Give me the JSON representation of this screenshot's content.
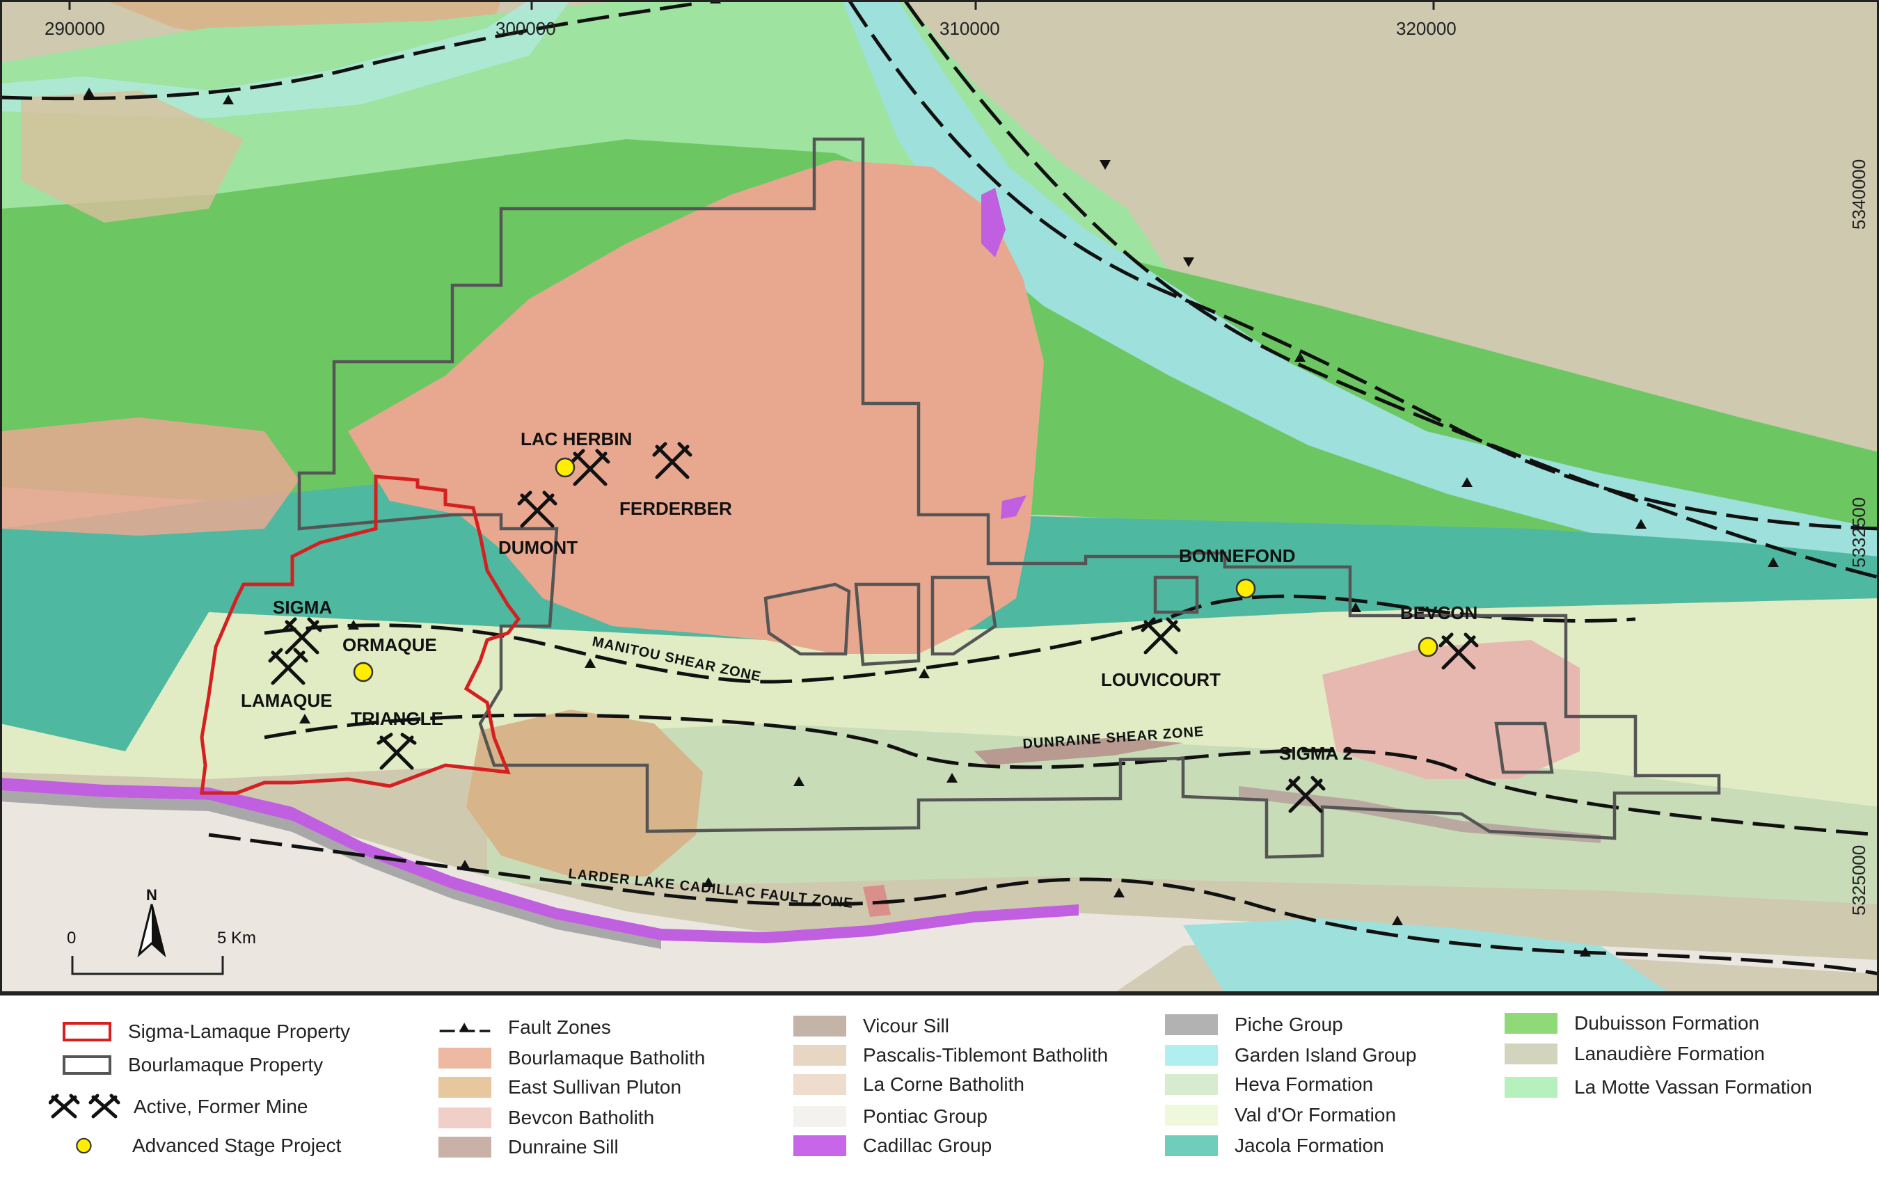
{
  "map": {
    "x_ticks": [
      "290000",
      "300000",
      "310000",
      "320000"
    ],
    "y_ticks": [
      "5340000",
      "5332500",
      "5325000"
    ],
    "places": {
      "lac_herbin": "LAC HERBIN",
      "ferderber": "FERDERBER",
      "dumont": "DUMONT",
      "sigma": "SIGMA",
      "ormaque": "ORMAQUE",
      "lamaque": "LAMAQUE",
      "triangle": "TRIANGLE",
      "bonnefond": "BONNEFOND",
      "bevcon": "BEVCON",
      "louvicourt": "LOUVICOURT",
      "sigma2": "SIGMA 2"
    },
    "faults": {
      "manitou": "MANITOU SHEAR ZONE",
      "dunraine": "DUNRAINE SHEAR ZONE",
      "larder": "LARDER LAKE CADILLAC FAULT ZONE"
    },
    "scale": {
      "start": "0",
      "end": "5 Km"
    },
    "north": "N",
    "colors": {
      "la_motte_vassan": "#9fe3a0",
      "dubuisson": "#6cc763",
      "jacola": "#4fb8a0",
      "val_dor": "#e1ecc4",
      "heva": "#c8dcb8",
      "garden_island": "#9ee0dc",
      "lanaudiere": "#cfc9b0",
      "bourlamaque": "#e8a890",
      "east_sullivan": "#d8b48a",
      "bevcon": "#e6b8b0",
      "dunraine": "#b89a90",
      "vicour": "#b8a8a0",
      "pontiac": "#ebe7e0",
      "cadillac": "#c060e0",
      "piche": "#a8a8a8",
      "sigma_outline": "#d42020",
      "bourlamaque_outline": "#555555",
      "advanced_project": "#ffee00"
    }
  },
  "legend": {
    "col1": [
      {
        "label": "Sigma-Lamaque Property",
        "icon": "red-outline-box"
      },
      {
        "label": "Bourlamaque Property",
        "icon": "grey-outline-box"
      },
      {
        "label": "Active, Former Mine",
        "icon": "mine-icon"
      },
      {
        "label": "Advanced Stage Project",
        "icon": "yellow-dot"
      }
    ],
    "col2": [
      {
        "label": "Fault Zones",
        "color": ""
      },
      {
        "label": "Bourlamaque Batholith",
        "color": "#eeb9a2"
      },
      {
        "label": "East Sullivan Pluton",
        "color": "#e8c79e"
      },
      {
        "label": "Bevcon Batholith",
        "color": "#efcfc8"
      },
      {
        "label": "Dunraine Sill",
        "color": "#c9b1a8"
      }
    ],
    "col3": [
      {
        "label": "Vicour Sill",
        "color": "#c4b4a8"
      },
      {
        "label": "Pascalis-Tiblemont Batholith",
        "color": "#e8d6c4"
      },
      {
        "label": "La Corne Batholith",
        "color": "#eedccc"
      },
      {
        "label": "Pontiac Group",
        "color": "#f4f2ee"
      },
      {
        "label": "Cadillac Group",
        "color": "#c766e8"
      }
    ],
    "col4": [
      {
        "label": "Piche Group",
        "color": "#b2b2b2"
      },
      {
        "label": "Garden Island Group",
        "color": "#b0efef"
      },
      {
        "label": "Heva Formation",
        "color": "#d7ebcf"
      },
      {
        "label": "Val d'Or Formation",
        "color": "#eef8da"
      },
      {
        "label": "Jacola Formation",
        "color": "#6fcdbb"
      }
    ],
    "col5": [
      {
        "label": "Dubuisson Formation",
        "color": "#8fd978"
      },
      {
        "label": "Lanaudière Formation",
        "color": "#d3d4bd"
      },
      {
        "label": "La Motte Vassan Formation",
        "color": "#b6f0bc"
      }
    ]
  }
}
